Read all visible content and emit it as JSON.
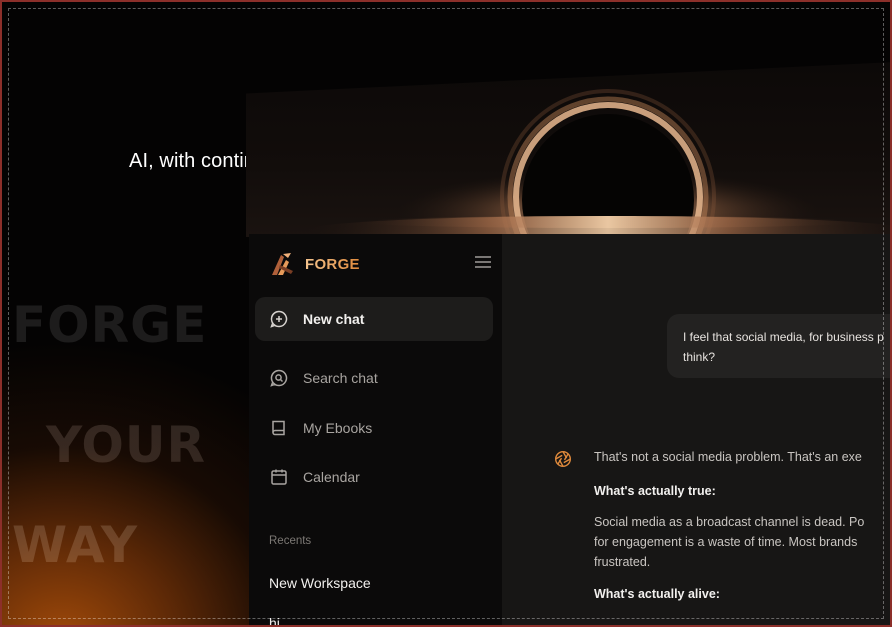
{
  "hero": {
    "tagline": "AI, with continuity",
    "bg_words": [
      "FORGE",
      "YOUR",
      "WAY"
    ]
  },
  "sidebar": {
    "brand": "FORGE",
    "new_chat": "New chat",
    "nav": [
      {
        "label": "Search chat",
        "icon": "search-chat-icon"
      },
      {
        "label": "My Ebooks",
        "icon": "book-icon"
      },
      {
        "label": "Calendar",
        "icon": "calendar-icon"
      }
    ],
    "recents_title": "Recents",
    "recents": [
      "New Workspace",
      "hi"
    ]
  },
  "chat": {
    "user_message_lines": [
      "I feel that social media, for business p",
      "think?"
    ],
    "ai_intro": "That's not a social media problem. That's an exe",
    "ai_heading_1": "What's actually true:",
    "ai_paragraph_lines": [
      "Social media as a broadcast channel is dead. Po",
      "for engagement is a waste of time. Most brands",
      "frustrated."
    ],
    "ai_heading_2": "What's actually alive:"
  },
  "colors": {
    "accent": "#e08a3c",
    "accent_light": "#f4c48e",
    "frame_border": "#8c2f2a"
  }
}
